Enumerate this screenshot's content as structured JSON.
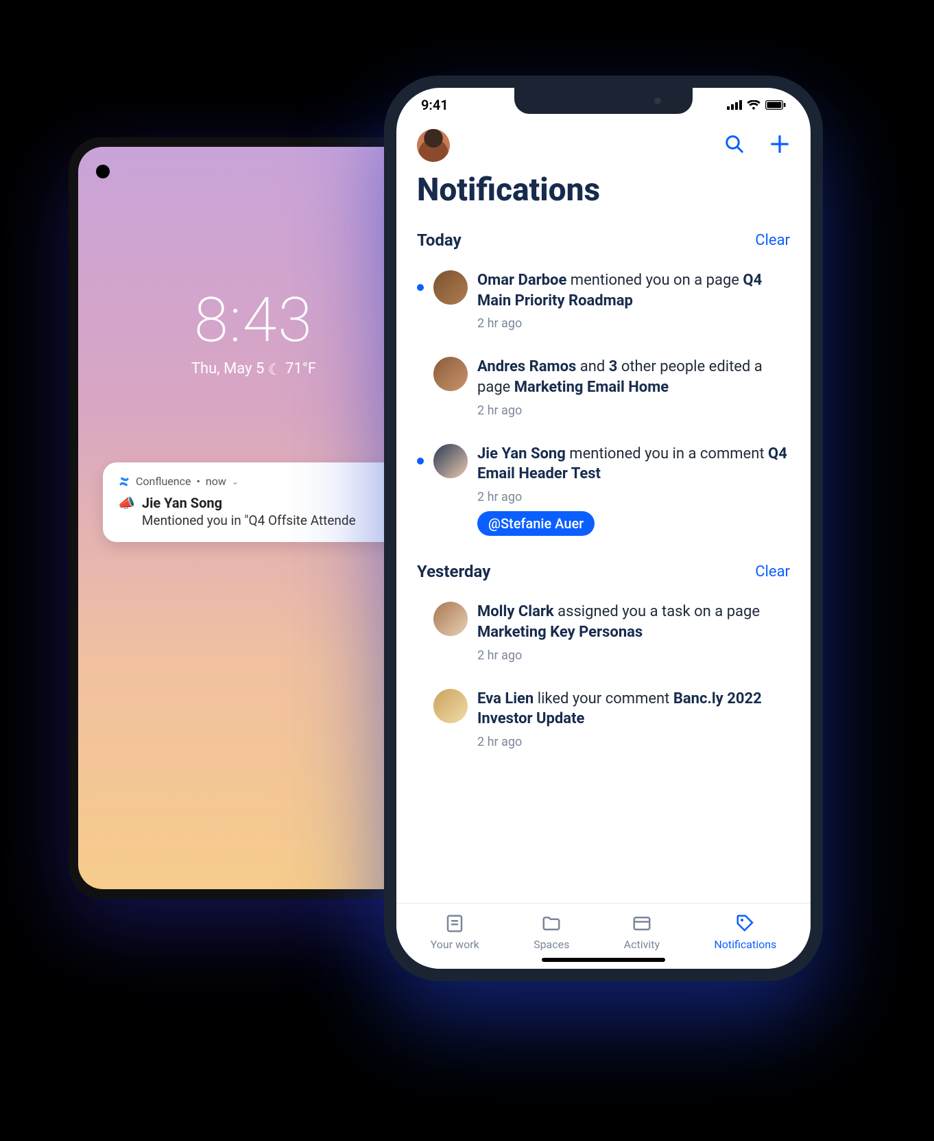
{
  "android": {
    "time": "8:43",
    "date": "Thu, May 5",
    "temp": "71°F",
    "notification": {
      "app": "Confluence",
      "when": "now",
      "sender": "Jie Yan Song",
      "message": "Mentioned you in \"Q4 Offsite Attende"
    }
  },
  "ios": {
    "statusbar_time": "9:41",
    "page_title": "Notifications",
    "sections": [
      {
        "title": "Today",
        "clear_label": "Clear",
        "items": [
          {
            "unread": true,
            "actor": "Omar Darboe",
            "mid1": " mentioned you on a page ",
            "target": "Q4 Main Priority Roadmap",
            "time": "2 hr ago"
          },
          {
            "unread": false,
            "actor": "Andres Ramos",
            "mid1": " and ",
            "count": "3",
            "mid2": " other people edited a page ",
            "target": "Marketing Email Home",
            "time": "2 hr ago"
          },
          {
            "unread": true,
            "actor": "Jie Yan Song",
            "mid1": " mentioned you in a comment ",
            "target": "Q4 Email Header Test",
            "time": "2 hr ago",
            "mention": "@Stefanie Auer"
          }
        ]
      },
      {
        "title": "Yesterday",
        "clear_label": "Clear",
        "items": [
          {
            "unread": false,
            "actor": "Molly Clark",
            "mid1": " assigned you a task on a page ",
            "target": "Marketing Key Personas",
            "time": "2 hr ago"
          },
          {
            "unread": false,
            "actor": "Eva Lien",
            "mid1": " liked your comment ",
            "target": "Banc.ly 2022 Investor Update",
            "time": "2 hr ago"
          }
        ]
      }
    ],
    "tabs": {
      "your_work": "Your work",
      "spaces": "Spaces",
      "activity": "Activity",
      "notifications": "Notifications"
    }
  }
}
